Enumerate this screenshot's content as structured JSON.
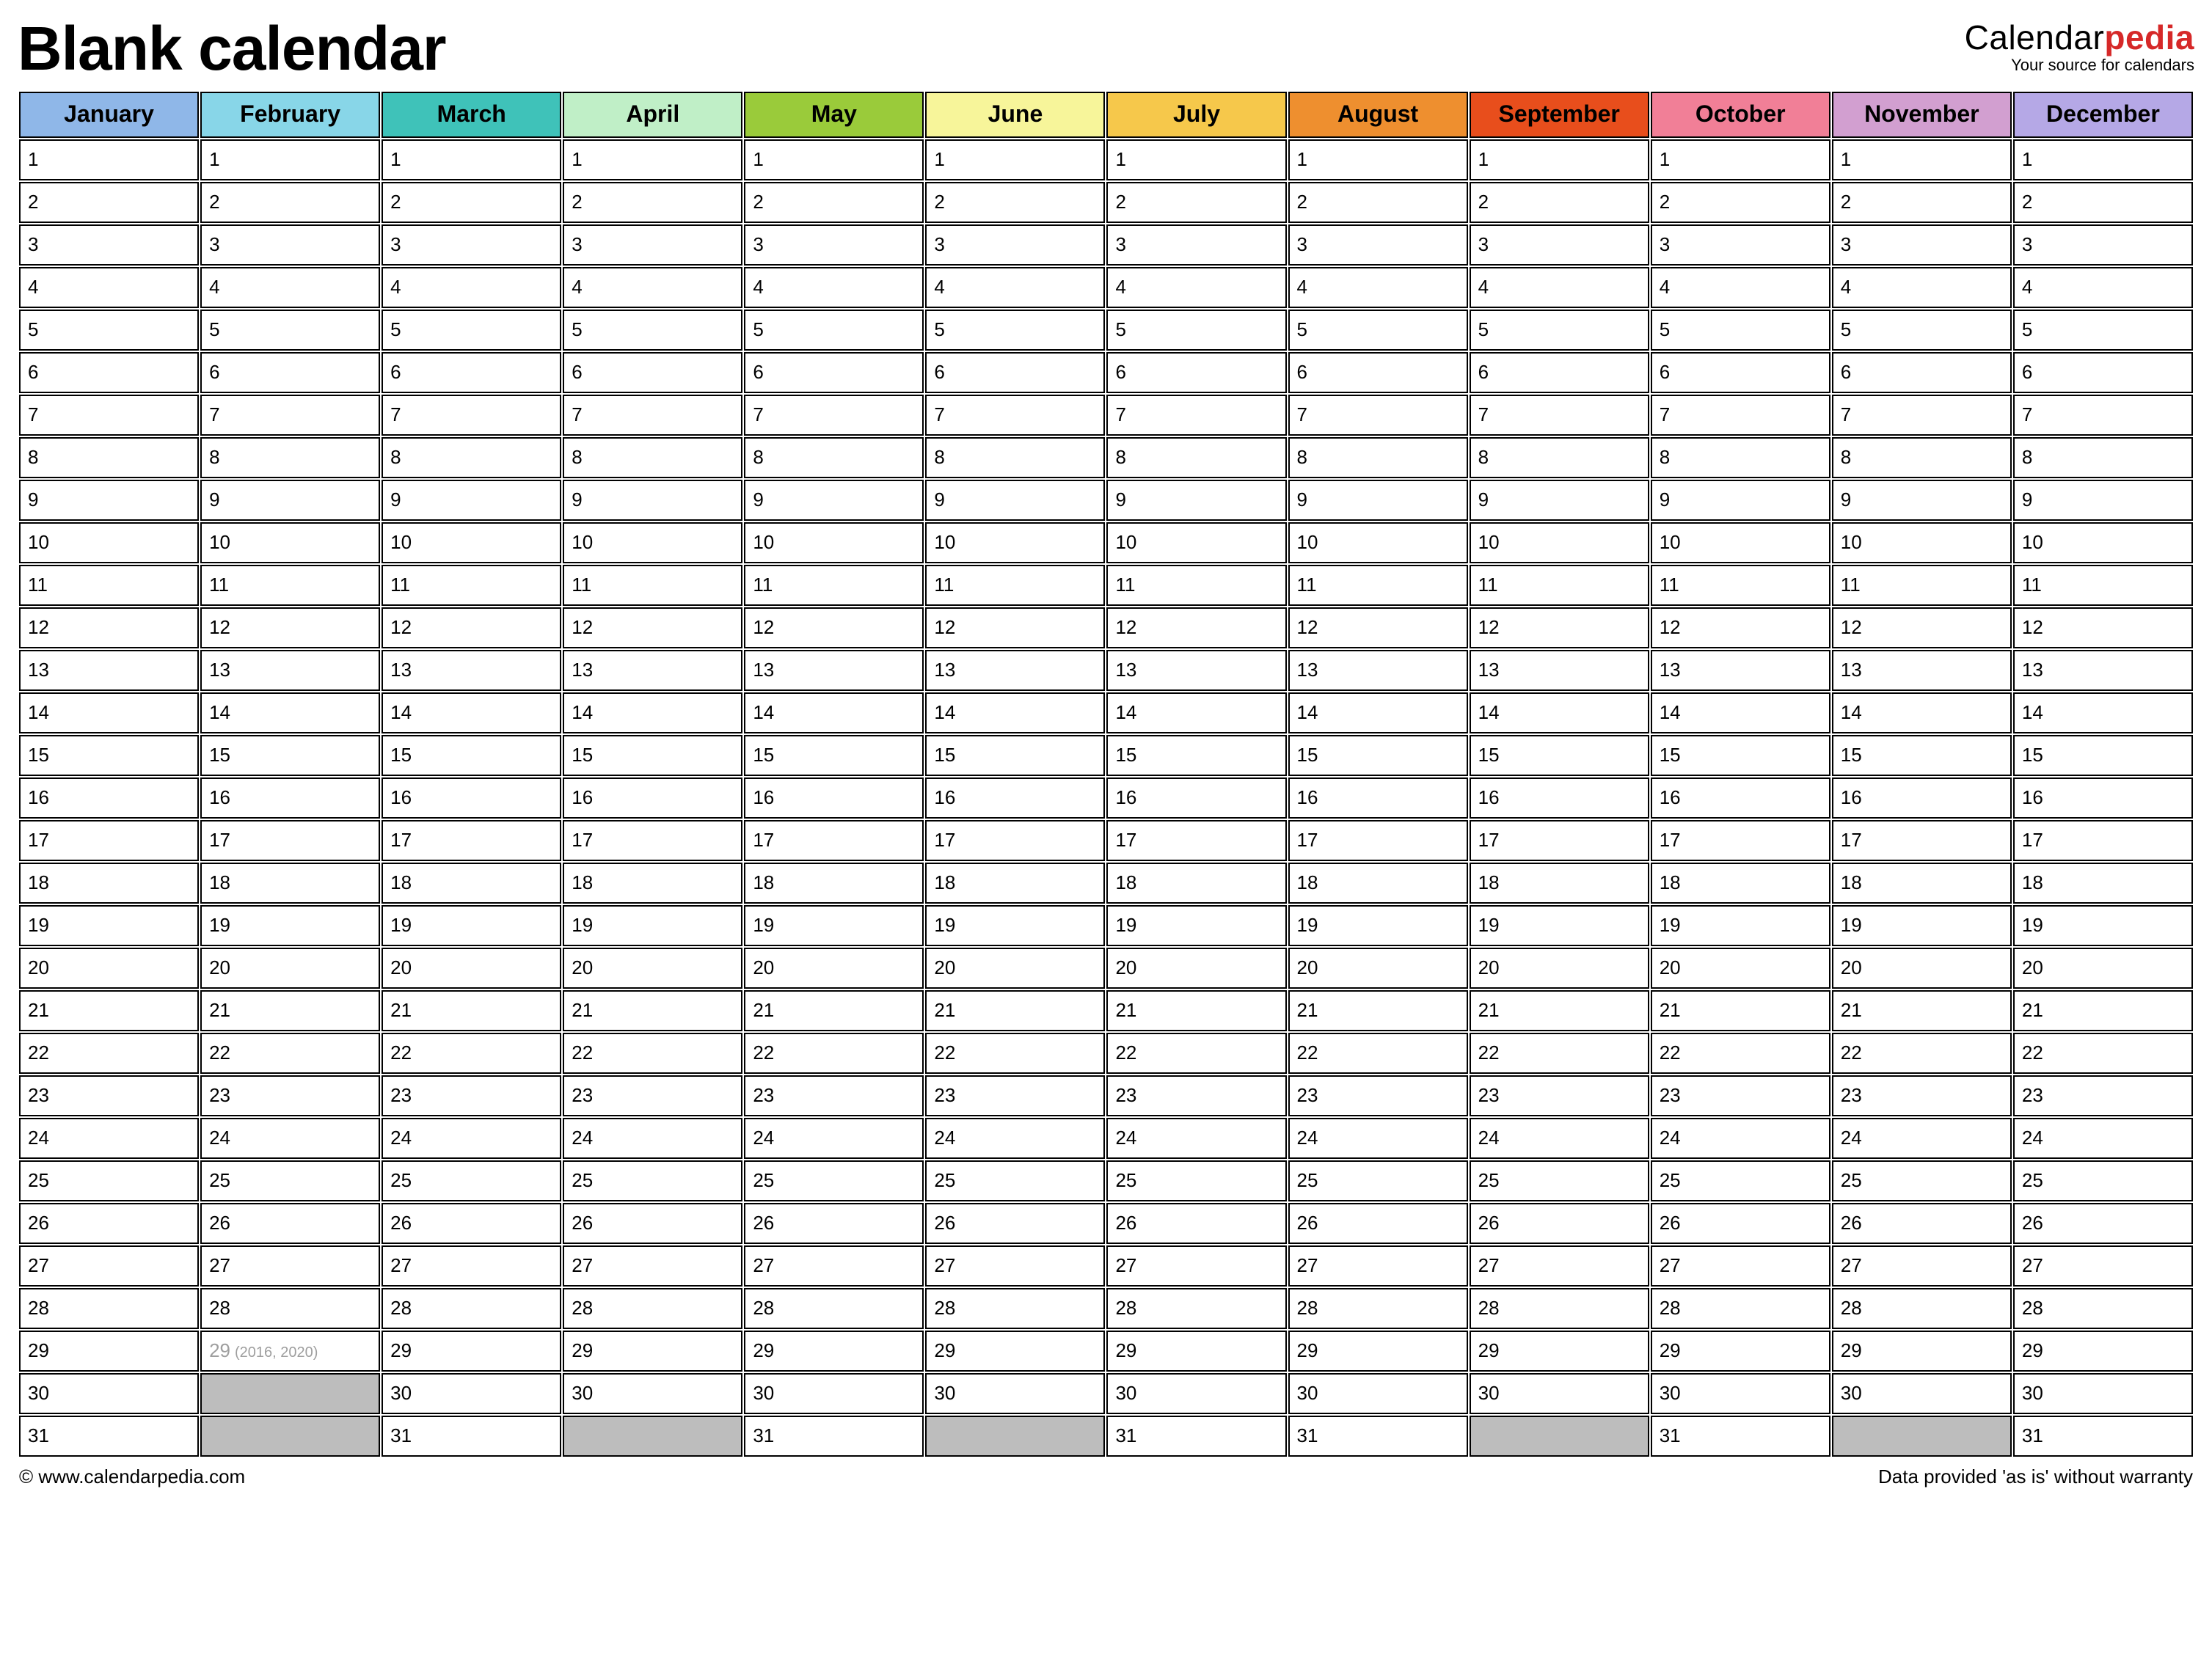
{
  "header": {
    "title": "Blank calendar",
    "brand_prefix": "Calendar",
    "brand_accent": "pedia",
    "brand_tagline": "Your source for calendars"
  },
  "months": [
    {
      "name": "January",
      "color": "#8fb7e8",
      "days": 31
    },
    {
      "name": "February",
      "color": "#88d6e8",
      "days": 28,
      "leap": {
        "day": 29,
        "note": "(2016, 2020)"
      }
    },
    {
      "name": "March",
      "color": "#3fc2b9",
      "days": 31
    },
    {
      "name": "April",
      "color": "#c0efc7",
      "days": 30
    },
    {
      "name": "May",
      "color": "#9acb3a",
      "days": 31
    },
    {
      "name": "June",
      "color": "#f7f59a",
      "days": 30
    },
    {
      "name": "July",
      "color": "#f6c84b",
      "days": 31
    },
    {
      "name": "August",
      "color": "#ee8f2f",
      "days": 31
    },
    {
      "name": "September",
      "color": "#e84e1c",
      "days": 30
    },
    {
      "name": "October",
      "color": "#f17f97",
      "days": 31
    },
    {
      "name": "November",
      "color": "#d29fd0",
      "days": 30
    },
    {
      "name": "December",
      "color": "#b5a8e6",
      "days": 31
    }
  ],
  "max_days": 31,
  "footer": {
    "left": "© www.calendarpedia.com",
    "right": "Data provided 'as is' without warranty"
  }
}
